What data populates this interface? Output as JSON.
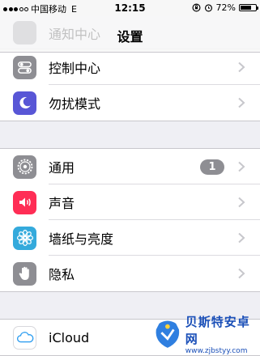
{
  "status_bar": {
    "carrier": "中国移动",
    "network": "E",
    "time": "12:15",
    "battery": "72%",
    "battery_level": 0.72
  },
  "nav": {
    "title": "设置",
    "ghost_label": "通知中心"
  },
  "groups": [
    {
      "items": [
        {
          "label": "控制中心",
          "icon": "control-center-icon",
          "color": "#8e8e93"
        },
        {
          "label": "勿扰模式",
          "icon": "moon-icon",
          "color": "#5856d6"
        }
      ]
    },
    {
      "items": [
        {
          "label": "通用",
          "icon": "gear-icon",
          "color": "#8e8e93",
          "badge": "1"
        },
        {
          "label": "声音",
          "icon": "speaker-icon",
          "color": "#ff2d55"
        },
        {
          "label": "墙纸与亮度",
          "icon": "flower-icon",
          "color": "#34aadc"
        },
        {
          "label": "隐私",
          "icon": "hand-icon",
          "color": "#8e8e93"
        }
      ]
    },
    {
      "items": [
        {
          "label": "iCloud",
          "icon": "cloud-icon",
          "color": "#ffffff"
        }
      ]
    }
  ],
  "watermark": {
    "title": "贝斯特安卓网",
    "url": "www.zjbstyy.com"
  }
}
